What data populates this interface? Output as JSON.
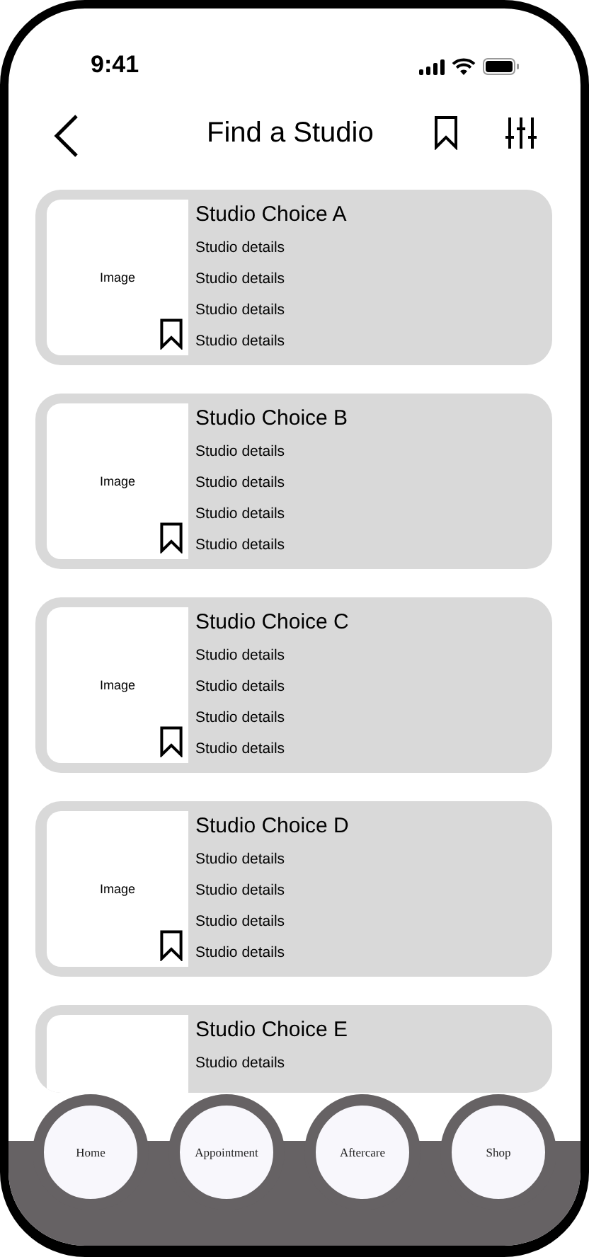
{
  "status_bar": {
    "time": "9:41"
  },
  "header": {
    "title": "Find a Studio"
  },
  "studios": [
    {
      "title": "Studio Choice A",
      "image_label": "Image",
      "bookmark": true,
      "details": [
        "Studio details",
        "Studio details",
        "Studio details",
        "Studio details"
      ]
    },
    {
      "title": "Studio Choice B",
      "image_label": "Image",
      "bookmark": true,
      "details": [
        "Studio details",
        "Studio details",
        "Studio details",
        "Studio details"
      ]
    },
    {
      "title": "Studio Choice C",
      "image_label": "Image",
      "bookmark": true,
      "details": [
        "Studio details",
        "Studio details",
        "Studio details",
        "Studio details"
      ]
    },
    {
      "title": "Studio Choice D",
      "image_label": "Image",
      "bookmark": true,
      "details": [
        "Studio details",
        "Studio details",
        "Studio details",
        "Studio details"
      ]
    },
    {
      "title": "Studio Choice E",
      "details": [
        "Studio details"
      ]
    }
  ],
  "nav": [
    {
      "label": "Home"
    },
    {
      "label": "Appointment"
    },
    {
      "label": "Aftercare"
    },
    {
      "label": "Shop"
    }
  ]
}
